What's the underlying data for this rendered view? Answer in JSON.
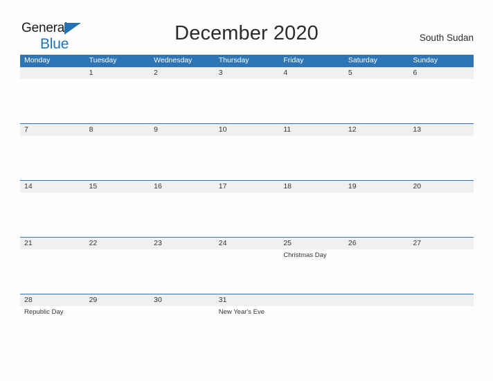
{
  "brand": {
    "name_part_1": "General",
    "name_part_2": "Blue",
    "flag_icon": "blue-triangle-flag-icon",
    "accent_color": "#2272b8"
  },
  "header": {
    "title": "December 2020",
    "region": "South Sudan"
  },
  "calendar": {
    "month": "December",
    "year": "2020",
    "header_color": "#2e75b6",
    "band_color": "#f0f0f0",
    "weekdays": [
      "Monday",
      "Tuesday",
      "Wednesday",
      "Thursday",
      "Friday",
      "Saturday",
      "Sunday"
    ],
    "weeks": [
      {
        "days": [
          {
            "date": "",
            "event": ""
          },
          {
            "date": "1",
            "event": ""
          },
          {
            "date": "2",
            "event": ""
          },
          {
            "date": "3",
            "event": ""
          },
          {
            "date": "4",
            "event": ""
          },
          {
            "date": "5",
            "event": ""
          },
          {
            "date": "6",
            "event": ""
          }
        ]
      },
      {
        "days": [
          {
            "date": "7",
            "event": ""
          },
          {
            "date": "8",
            "event": ""
          },
          {
            "date": "9",
            "event": ""
          },
          {
            "date": "10",
            "event": ""
          },
          {
            "date": "11",
            "event": ""
          },
          {
            "date": "12",
            "event": ""
          },
          {
            "date": "13",
            "event": ""
          }
        ]
      },
      {
        "days": [
          {
            "date": "14",
            "event": ""
          },
          {
            "date": "15",
            "event": ""
          },
          {
            "date": "16",
            "event": ""
          },
          {
            "date": "17",
            "event": ""
          },
          {
            "date": "18",
            "event": ""
          },
          {
            "date": "19",
            "event": ""
          },
          {
            "date": "20",
            "event": ""
          }
        ]
      },
      {
        "days": [
          {
            "date": "21",
            "event": ""
          },
          {
            "date": "22",
            "event": ""
          },
          {
            "date": "23",
            "event": ""
          },
          {
            "date": "24",
            "event": ""
          },
          {
            "date": "25",
            "event": "Christmas Day"
          },
          {
            "date": "26",
            "event": ""
          },
          {
            "date": "27",
            "event": ""
          }
        ]
      },
      {
        "days": [
          {
            "date": "28",
            "event": "Republic Day"
          },
          {
            "date": "29",
            "event": ""
          },
          {
            "date": "30",
            "event": ""
          },
          {
            "date": "31",
            "event": "New Year's Eve"
          },
          {
            "date": "",
            "event": ""
          },
          {
            "date": "",
            "event": ""
          },
          {
            "date": "",
            "event": ""
          }
        ]
      }
    ]
  }
}
